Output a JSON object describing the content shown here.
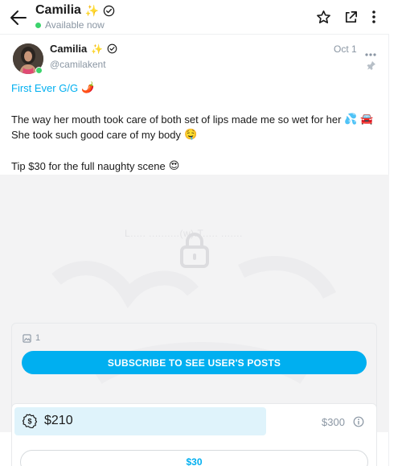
{
  "header": {
    "name": "Camilia",
    "name_emoji": "✨",
    "status": "Available now"
  },
  "post": {
    "name": "Camilia",
    "name_emoji": "✨",
    "handle": "@camilakent",
    "date": "Oct 1",
    "caption": [
      {
        "text": "First Ever G/G",
        "emoji": "🌶️"
      },
      {
        "text": "The way her mouth took care of both set of lips made me so wet for her",
        "emoji": "💦 🚘"
      },
      {
        "text": "She took such good care of my body",
        "emoji": "🤤"
      },
      {
        "text": "Tip $30 for the full naughty scene",
        "emoji": "😍"
      }
    ],
    "locked_media": {
      "ghost_text": "L..... ..........(w).T..... .......",
      "media_count": "1",
      "subscribe_label": "SUBSCRIBE TO SEE USER'S POSTS"
    },
    "tip_goal": {
      "collected": "$210",
      "goal": "$300",
      "progress_fraction": 0.7,
      "tip_button_label": "$30"
    }
  },
  "colors": {
    "accent": "#00aff0",
    "online": "#3bd36c",
    "muted": "#8a96a3",
    "progress_fill": "#dff3fb"
  }
}
